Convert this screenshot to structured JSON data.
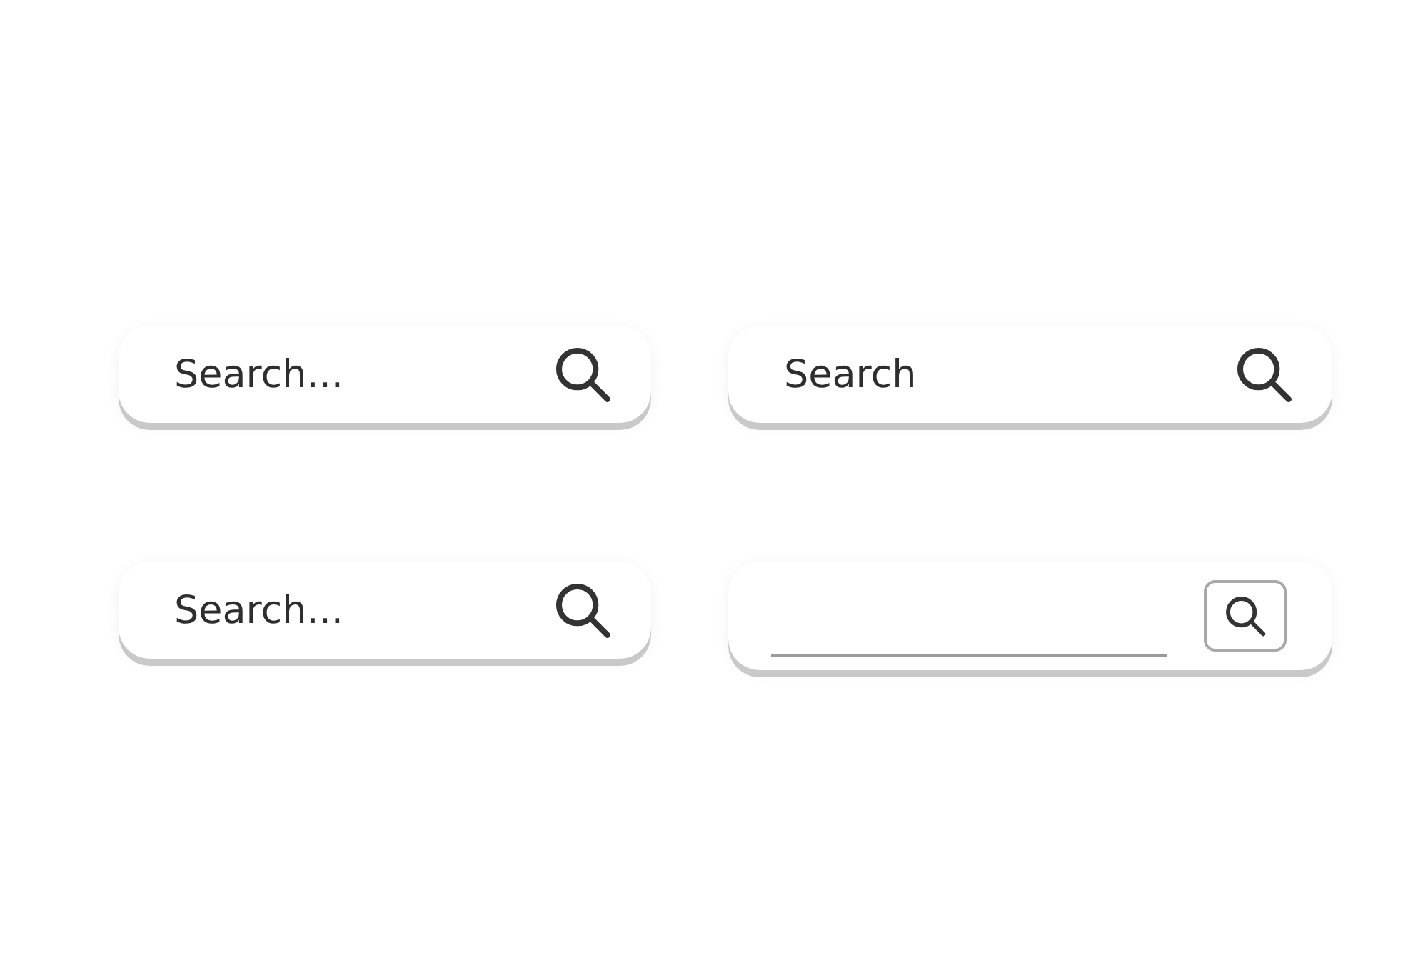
{
  "search_bars": [
    {
      "kind": "pill",
      "placeholder": "Search..."
    },
    {
      "kind": "pill",
      "placeholder": "Search"
    },
    {
      "kind": "pill",
      "placeholder": "Search..."
    },
    {
      "kind": "underline"
    }
  ]
}
